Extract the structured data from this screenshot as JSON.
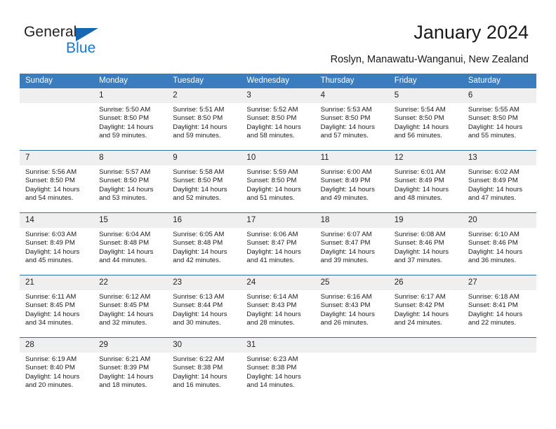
{
  "brand": {
    "name_top": "General",
    "name_bottom": "Blue",
    "accent_color": "#1878cf",
    "triangle_color": "#1567b2"
  },
  "header": {
    "title": "January 2024",
    "subtitle": "Roslyn, Manawatu-Wanganui, New Zealand"
  },
  "calendar": {
    "header_bg": "#3a7cbe",
    "header_text_color": "#ffffff",
    "daynum_bg": "#efefef",
    "week_separator_color": "#2f6fad",
    "weekday_headers": [
      "Sunday",
      "Monday",
      "Tuesday",
      "Wednesday",
      "Thursday",
      "Friday",
      "Saturday"
    ],
    "weeks": [
      [
        {
          "day": "",
          "sunrise": "",
          "sunset": "",
          "daylight_line1": "",
          "daylight_line2": ""
        },
        {
          "day": "1",
          "sunrise": "Sunrise: 5:50 AM",
          "sunset": "Sunset: 8:50 PM",
          "daylight_line1": "Daylight: 14 hours",
          "daylight_line2": "and 59 minutes."
        },
        {
          "day": "2",
          "sunrise": "Sunrise: 5:51 AM",
          "sunset": "Sunset: 8:50 PM",
          "daylight_line1": "Daylight: 14 hours",
          "daylight_line2": "and 59 minutes."
        },
        {
          "day": "3",
          "sunrise": "Sunrise: 5:52 AM",
          "sunset": "Sunset: 8:50 PM",
          "daylight_line1": "Daylight: 14 hours",
          "daylight_line2": "and 58 minutes."
        },
        {
          "day": "4",
          "sunrise": "Sunrise: 5:53 AM",
          "sunset": "Sunset: 8:50 PM",
          "daylight_line1": "Daylight: 14 hours",
          "daylight_line2": "and 57 minutes."
        },
        {
          "day": "5",
          "sunrise": "Sunrise: 5:54 AM",
          "sunset": "Sunset: 8:50 PM",
          "daylight_line1": "Daylight: 14 hours",
          "daylight_line2": "and 56 minutes."
        },
        {
          "day": "6",
          "sunrise": "Sunrise: 5:55 AM",
          "sunset": "Sunset: 8:50 PM",
          "daylight_line1": "Daylight: 14 hours",
          "daylight_line2": "and 55 minutes."
        }
      ],
      [
        {
          "day": "7",
          "sunrise": "Sunrise: 5:56 AM",
          "sunset": "Sunset: 8:50 PM",
          "daylight_line1": "Daylight: 14 hours",
          "daylight_line2": "and 54 minutes."
        },
        {
          "day": "8",
          "sunrise": "Sunrise: 5:57 AM",
          "sunset": "Sunset: 8:50 PM",
          "daylight_line1": "Daylight: 14 hours",
          "daylight_line2": "and 53 minutes."
        },
        {
          "day": "9",
          "sunrise": "Sunrise: 5:58 AM",
          "sunset": "Sunset: 8:50 PM",
          "daylight_line1": "Daylight: 14 hours",
          "daylight_line2": "and 52 minutes."
        },
        {
          "day": "10",
          "sunrise": "Sunrise: 5:59 AM",
          "sunset": "Sunset: 8:50 PM",
          "daylight_line1": "Daylight: 14 hours",
          "daylight_line2": "and 51 minutes."
        },
        {
          "day": "11",
          "sunrise": "Sunrise: 6:00 AM",
          "sunset": "Sunset: 8:49 PM",
          "daylight_line1": "Daylight: 14 hours",
          "daylight_line2": "and 49 minutes."
        },
        {
          "day": "12",
          "sunrise": "Sunrise: 6:01 AM",
          "sunset": "Sunset: 8:49 PM",
          "daylight_line1": "Daylight: 14 hours",
          "daylight_line2": "and 48 minutes."
        },
        {
          "day": "13",
          "sunrise": "Sunrise: 6:02 AM",
          "sunset": "Sunset: 8:49 PM",
          "daylight_line1": "Daylight: 14 hours",
          "daylight_line2": "and 47 minutes."
        }
      ],
      [
        {
          "day": "14",
          "sunrise": "Sunrise: 6:03 AM",
          "sunset": "Sunset: 8:49 PM",
          "daylight_line1": "Daylight: 14 hours",
          "daylight_line2": "and 45 minutes."
        },
        {
          "day": "15",
          "sunrise": "Sunrise: 6:04 AM",
          "sunset": "Sunset: 8:48 PM",
          "daylight_line1": "Daylight: 14 hours",
          "daylight_line2": "and 44 minutes."
        },
        {
          "day": "16",
          "sunrise": "Sunrise: 6:05 AM",
          "sunset": "Sunset: 8:48 PM",
          "daylight_line1": "Daylight: 14 hours",
          "daylight_line2": "and 42 minutes."
        },
        {
          "day": "17",
          "sunrise": "Sunrise: 6:06 AM",
          "sunset": "Sunset: 8:47 PM",
          "daylight_line1": "Daylight: 14 hours",
          "daylight_line2": "and 41 minutes."
        },
        {
          "day": "18",
          "sunrise": "Sunrise: 6:07 AM",
          "sunset": "Sunset: 8:47 PM",
          "daylight_line1": "Daylight: 14 hours",
          "daylight_line2": "and 39 minutes."
        },
        {
          "day": "19",
          "sunrise": "Sunrise: 6:08 AM",
          "sunset": "Sunset: 8:46 PM",
          "daylight_line1": "Daylight: 14 hours",
          "daylight_line2": "and 37 minutes."
        },
        {
          "day": "20",
          "sunrise": "Sunrise: 6:10 AM",
          "sunset": "Sunset: 8:46 PM",
          "daylight_line1": "Daylight: 14 hours",
          "daylight_line2": "and 36 minutes."
        }
      ],
      [
        {
          "day": "21",
          "sunrise": "Sunrise: 6:11 AM",
          "sunset": "Sunset: 8:45 PM",
          "daylight_line1": "Daylight: 14 hours",
          "daylight_line2": "and 34 minutes."
        },
        {
          "day": "22",
          "sunrise": "Sunrise: 6:12 AM",
          "sunset": "Sunset: 8:45 PM",
          "daylight_line1": "Daylight: 14 hours",
          "daylight_line2": "and 32 minutes."
        },
        {
          "day": "23",
          "sunrise": "Sunrise: 6:13 AM",
          "sunset": "Sunset: 8:44 PM",
          "daylight_line1": "Daylight: 14 hours",
          "daylight_line2": "and 30 minutes."
        },
        {
          "day": "24",
          "sunrise": "Sunrise: 6:14 AM",
          "sunset": "Sunset: 8:43 PM",
          "daylight_line1": "Daylight: 14 hours",
          "daylight_line2": "and 28 minutes."
        },
        {
          "day": "25",
          "sunrise": "Sunrise: 6:16 AM",
          "sunset": "Sunset: 8:43 PM",
          "daylight_line1": "Daylight: 14 hours",
          "daylight_line2": "and 26 minutes."
        },
        {
          "day": "26",
          "sunrise": "Sunrise: 6:17 AM",
          "sunset": "Sunset: 8:42 PM",
          "daylight_line1": "Daylight: 14 hours",
          "daylight_line2": "and 24 minutes."
        },
        {
          "day": "27",
          "sunrise": "Sunrise: 6:18 AM",
          "sunset": "Sunset: 8:41 PM",
          "daylight_line1": "Daylight: 14 hours",
          "daylight_line2": "and 22 minutes."
        }
      ],
      [
        {
          "day": "28",
          "sunrise": "Sunrise: 6:19 AM",
          "sunset": "Sunset: 8:40 PM",
          "daylight_line1": "Daylight: 14 hours",
          "daylight_line2": "and 20 minutes."
        },
        {
          "day": "29",
          "sunrise": "Sunrise: 6:21 AM",
          "sunset": "Sunset: 8:39 PM",
          "daylight_line1": "Daylight: 14 hours",
          "daylight_line2": "and 18 minutes."
        },
        {
          "day": "30",
          "sunrise": "Sunrise: 6:22 AM",
          "sunset": "Sunset: 8:38 PM",
          "daylight_line1": "Daylight: 14 hours",
          "daylight_line2": "and 16 minutes."
        },
        {
          "day": "31",
          "sunrise": "Sunrise: 6:23 AM",
          "sunset": "Sunset: 8:38 PM",
          "daylight_line1": "Daylight: 14 hours",
          "daylight_line2": "and 14 minutes."
        },
        {
          "day": "",
          "sunrise": "",
          "sunset": "",
          "daylight_line1": "",
          "daylight_line2": ""
        },
        {
          "day": "",
          "sunrise": "",
          "sunset": "",
          "daylight_line1": "",
          "daylight_line2": ""
        },
        {
          "day": "",
          "sunrise": "",
          "sunset": "",
          "daylight_line1": "",
          "daylight_line2": ""
        }
      ]
    ]
  }
}
